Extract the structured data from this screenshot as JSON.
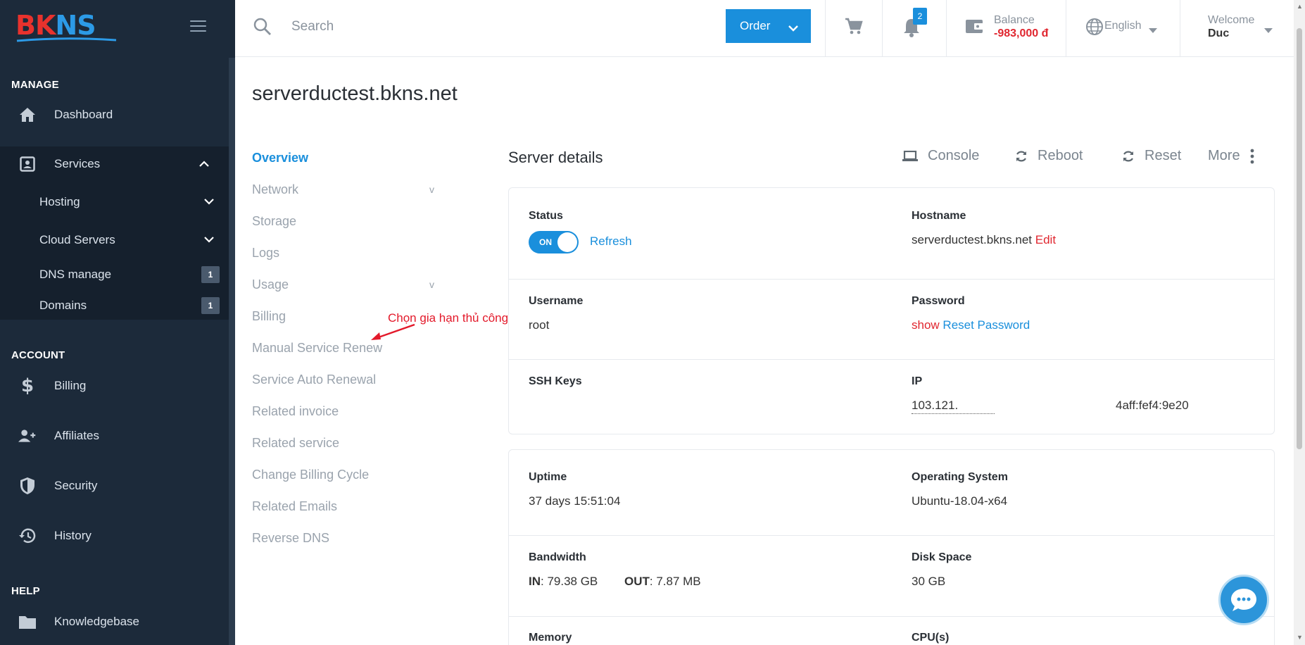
{
  "brand": {
    "logo_b": "B",
    "logo_k": "K",
    "logo_n": "N",
    "logo_s": "S"
  },
  "sidebar": {
    "manage_title": "MANAGE",
    "account_title": "ACCOUNT",
    "help_title": "HELP",
    "dashboard": "Dashboard",
    "services": "Services",
    "hosting": "Hosting",
    "cloud_servers": "Cloud Servers",
    "dns_manage": "DNS manage",
    "dns_badge": "1",
    "domains": "Domains",
    "domains_badge": "1",
    "billing": "Billing",
    "affiliates": "Affiliates",
    "security": "Security",
    "history": "History",
    "knowledgebase": "Knowledgebase"
  },
  "topbar": {
    "search_placeholder": "Search",
    "order_label": "Order",
    "notification_count": "2",
    "balance_label": "Balance",
    "balance_value": "-983,000 đ",
    "language": "English",
    "welcome_label": "Welcome",
    "welcome_name": "Duc"
  },
  "page": {
    "title": "serverductest.bkns.net"
  },
  "subnav": {
    "overview": "Overview",
    "network": "Network",
    "storage": "Storage",
    "logs": "Logs",
    "usage": "Usage",
    "billing": "Billing",
    "manual_renew": "Manual Service Renew",
    "auto_renewal": "Service Auto Renewal",
    "related_invoice": "Related invoice",
    "related_service": "Related service",
    "change_cycle": "Change Billing Cycle",
    "related_emails": "Related Emails",
    "reverse_dns": "Reverse DNS",
    "chevron": "v"
  },
  "annotation": "Chọn gia hạn thủ công",
  "server_details": {
    "title": "Server details",
    "console": "Console",
    "reboot": "Reboot",
    "reset": "Reset",
    "more": "More",
    "status_label": "Status",
    "status_toggle": "ON",
    "refresh": "Refresh",
    "hostname_label": "Hostname",
    "hostname_value": "serverductest.bkns.net",
    "edit": "Edit",
    "username_label": "Username",
    "username_value": "root",
    "password_label": "Password",
    "show": "show",
    "reset_password": "Reset Password",
    "ssh_label": "SSH Keys",
    "ip_label": "IP",
    "ip_v4": "103.121.",
    "ip_v6": "4aff:fef4:9e20",
    "uptime_label": "Uptime",
    "uptime_value": "37 days 15:51:04",
    "os_label": "Operating System",
    "os_value": "Ubuntu-18.04-x64",
    "bandwidth_label": "Bandwidth",
    "bw_in_label": "IN",
    "bw_in_value": ": 79.38 GB",
    "bw_out_label": "OUT",
    "bw_out_value": ": 7.87 MB",
    "disk_label": "Disk Space",
    "disk_value": "30 GB",
    "memory_label": "Memory",
    "cpu_label": "CPU(s)"
  },
  "colors": {
    "sidebar_bg": "#1c2a3a",
    "accent": "#1a8fdc",
    "danger": "#e0262f"
  }
}
